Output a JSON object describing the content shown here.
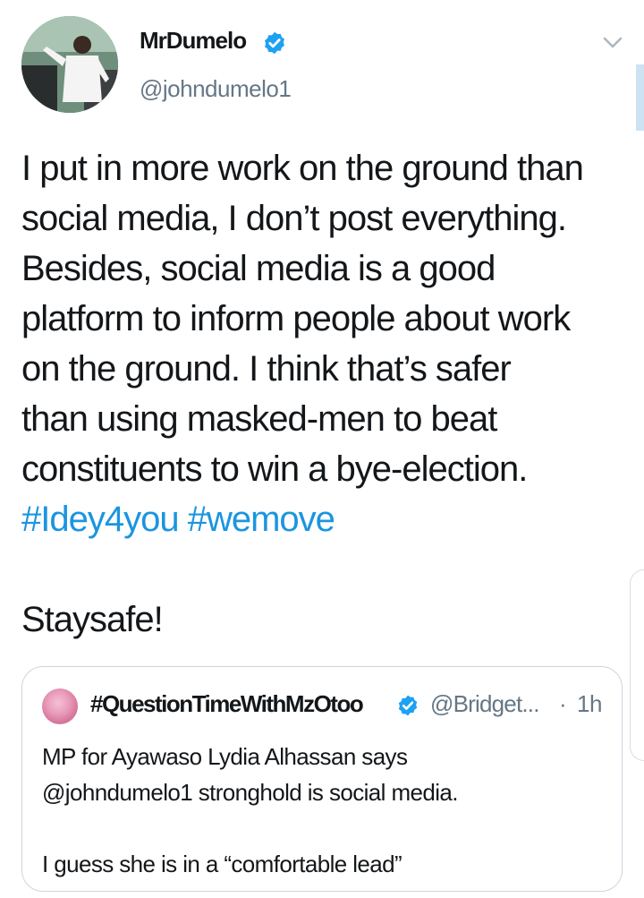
{
  "author": {
    "display_name": "MrDumelo",
    "handle": "@johndumelo1",
    "verified": true
  },
  "tweet": {
    "lines": [
      "I put in more work on the ground than",
      "social media, I don’t post everything.",
      "Besides, social media is a good",
      "platform to inform people about work",
      "on the ground. I think that’s safer",
      "than using masked-men to beat",
      "constituents to win a bye-election."
    ],
    "hashtags": [
      "#Idey4you",
      "#wemove"
    ],
    "closing": "Staysafe!"
  },
  "quoted_tweet": {
    "display_name": "#QuestionTimeWithMzOtoo",
    "handle": "@Bridget...",
    "separator": "·",
    "time": "1h",
    "verified": true,
    "lines": [
      "MP for Ayawaso Lydia Alhassan says",
      "@johndumelo1 stronghold is social media.",
      "",
      "I guess she is in a “comfortable lead”"
    ]
  },
  "icons": {
    "verified": "verified-badge-icon",
    "menu": "chevron-down-icon"
  },
  "colors": {
    "link": "#1b95e0",
    "verified": "#1da1f2",
    "secondary_text": "#657786",
    "border": "#ccd6dd"
  }
}
